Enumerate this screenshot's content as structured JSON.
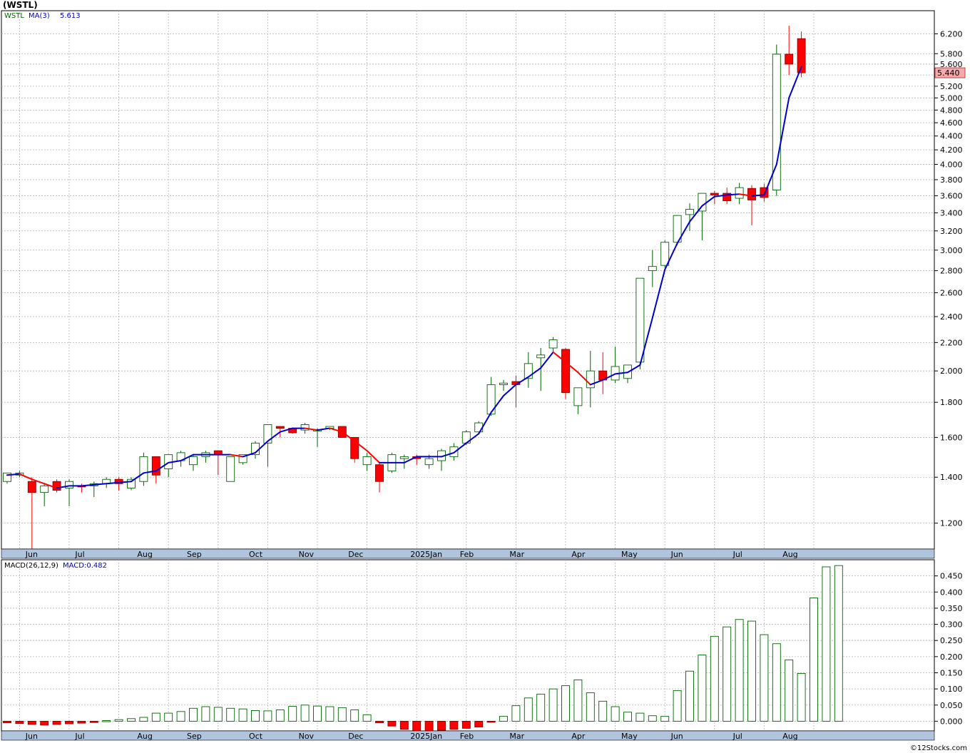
{
  "title": "(WSTL)",
  "copyright": "©12Stocks.com",
  "colors": {
    "up": "#006400",
    "down": "#ff0000",
    "ma_rising": "#0000cd",
    "ma_falling": "#ff0000",
    "axis_band": "#b0c4de",
    "grid": "#b4b4b4",
    "last_label_bg": "#f4aaaa"
  },
  "chart_data": [
    {
      "type": "candlestick",
      "ticker": "WSTL",
      "legend": {
        "ticker": "WSTL",
        "ma_label": "MA(3)",
        "ma_value": "5.613"
      },
      "last_price_label": "5.440",
      "y_scale": "log",
      "ylim": [
        1.1,
        6.7
      ],
      "y_ticks": [
        "1.200",
        "1.400",
        "1.600",
        "1.800",
        "2.000",
        "2.200",
        "2.400",
        "2.600",
        "2.800",
        "3.000",
        "3.200",
        "3.400",
        "3.600",
        "3.800",
        "4.000",
        "4.200",
        "4.400",
        "4.600",
        "4.800",
        "5.000",
        "5.200",
        "5.400",
        "5.600",
        "5.800",
        "6.200"
      ],
      "month_labels": [
        {
          "label": "Jun",
          "week": 2
        },
        {
          "label": "Jul",
          "week": 6
        },
        {
          "label": "Aug",
          "week": 11
        },
        {
          "label": "Sep",
          "week": 15
        },
        {
          "label": "Oct",
          "week": 20
        },
        {
          "label": "Nov",
          "week": 24
        },
        {
          "label": "Dec",
          "week": 28
        },
        {
          "label": "2025Jan",
          "week": 33
        },
        {
          "label": "Feb",
          "week": 37
        },
        {
          "label": "Mar",
          "week": 41
        },
        {
          "label": "Apr",
          "week": 46
        },
        {
          "label": "May",
          "week": 50
        },
        {
          "label": "Jun",
          "week": 54
        },
        {
          "label": "Jul",
          "week": 59
        },
        {
          "label": "Aug",
          "week": 63
        }
      ],
      "candles": [
        {
          "o": 1.38,
          "h": 1.42,
          "l": 1.37,
          "c": 1.42
        },
        {
          "o": 1.41,
          "h": 1.43,
          "l": 1.4,
          "c": 1.42
        },
        {
          "o": 1.38,
          "h": 1.4,
          "l": 1.09,
          "c": 1.33
        },
        {
          "o": 1.33,
          "h": 1.37,
          "l": 1.27,
          "c": 1.36
        },
        {
          "o": 1.38,
          "h": 1.39,
          "l": 1.33,
          "c": 1.34
        },
        {
          "o": 1.35,
          "h": 1.39,
          "l": 1.27,
          "c": 1.38
        },
        {
          "o": 1.36,
          "h": 1.37,
          "l": 1.33,
          "c": 1.355
        },
        {
          "o": 1.36,
          "h": 1.38,
          "l": 1.31,
          "c": 1.37
        },
        {
          "o": 1.37,
          "h": 1.4,
          "l": 1.35,
          "c": 1.39
        },
        {
          "o": 1.39,
          "h": 1.4,
          "l": 1.34,
          "c": 1.37
        },
        {
          "o": 1.35,
          "h": 1.4,
          "l": 1.34,
          "c": 1.39
        },
        {
          "o": 1.38,
          "h": 1.52,
          "l": 1.36,
          "c": 1.5
        },
        {
          "o": 1.5,
          "h": 1.5,
          "l": 1.37,
          "c": 1.41
        },
        {
          "o": 1.44,
          "h": 1.51,
          "l": 1.4,
          "c": 1.51
        },
        {
          "o": 1.48,
          "h": 1.53,
          "l": 1.45,
          "c": 1.52
        },
        {
          "o": 1.46,
          "h": 1.51,
          "l": 1.43,
          "c": 1.5
        },
        {
          "o": 1.5,
          "h": 1.53,
          "l": 1.47,
          "c": 1.52
        },
        {
          "o": 1.53,
          "h": 1.53,
          "l": 1.41,
          "c": 1.51
        },
        {
          "o": 1.38,
          "h": 1.5,
          "l": 1.38,
          "c": 1.5
        },
        {
          "o": 1.47,
          "h": 1.51,
          "l": 1.46,
          "c": 1.51
        },
        {
          "o": 1.51,
          "h": 1.58,
          "l": 1.49,
          "c": 1.57
        },
        {
          "o": 1.57,
          "h": 1.67,
          "l": 1.45,
          "c": 1.67
        },
        {
          "o": 1.66,
          "h": 1.66,
          "l": 1.6,
          "c": 1.65
        },
        {
          "o": 1.65,
          "h": 1.65,
          "l": 1.62,
          "c": 1.625
        },
        {
          "o": 1.64,
          "h": 1.68,
          "l": 1.62,
          "c": 1.67
        },
        {
          "o": 1.64,
          "h": 1.65,
          "l": 1.55,
          "c": 1.64
        },
        {
          "o": 1.65,
          "h": 1.66,
          "l": 1.64,
          "c": 1.66
        },
        {
          "o": 1.66,
          "h": 1.66,
          "l": 1.6,
          "c": 1.6
        },
        {
          "o": 1.6,
          "h": 1.6,
          "l": 1.47,
          "c": 1.49
        },
        {
          "o": 1.46,
          "h": 1.52,
          "l": 1.43,
          "c": 1.5
        },
        {
          "o": 1.46,
          "h": 1.47,
          "l": 1.33,
          "c": 1.38
        },
        {
          "o": 1.43,
          "h": 1.52,
          "l": 1.42,
          "c": 1.51
        },
        {
          "o": 1.49,
          "h": 1.51,
          "l": 1.44,
          "c": 1.5
        },
        {
          "o": 1.5,
          "h": 1.51,
          "l": 1.46,
          "c": 1.49
        },
        {
          "o": 1.46,
          "h": 1.51,
          "l": 1.44,
          "c": 1.49
        },
        {
          "o": 1.48,
          "h": 1.54,
          "l": 1.43,
          "c": 1.53
        },
        {
          "o": 1.5,
          "h": 1.57,
          "l": 1.48,
          "c": 1.55
        },
        {
          "o": 1.57,
          "h": 1.64,
          "l": 1.56,
          "c": 1.63
        },
        {
          "o": 1.63,
          "h": 1.69,
          "l": 1.62,
          "c": 1.68
        },
        {
          "o": 1.73,
          "h": 1.96,
          "l": 1.72,
          "c": 1.91
        },
        {
          "o": 1.91,
          "h": 1.94,
          "l": 1.87,
          "c": 1.92
        },
        {
          "o": 1.93,
          "h": 1.97,
          "l": 1.77,
          "c": 1.91
        },
        {
          "o": 1.95,
          "h": 2.13,
          "l": 1.89,
          "c": 2.05
        },
        {
          "o": 2.09,
          "h": 2.16,
          "l": 1.87,
          "c": 2.11
        },
        {
          "o": 2.16,
          "h": 2.24,
          "l": 2.13,
          "c": 2.22
        },
        {
          "o": 2.15,
          "h": 2.16,
          "l": 1.82,
          "c": 1.86
        },
        {
          "o": 1.78,
          "h": 1.89,
          "l": 1.73,
          "c": 1.89
        },
        {
          "o": 1.89,
          "h": 2.14,
          "l": 1.77,
          "c": 2.0
        },
        {
          "o": 2.0,
          "h": 2.13,
          "l": 1.85,
          "c": 1.94
        },
        {
          "o": 1.94,
          "h": 2.17,
          "l": 1.92,
          "c": 2.03
        },
        {
          "o": 1.95,
          "h": 2.02,
          "l": 1.92,
          "c": 2.04
        },
        {
          "o": 2.06,
          "h": 2.73,
          "l": 2.01,
          "c": 2.73
        },
        {
          "o": 2.8,
          "h": 3.0,
          "l": 2.65,
          "c": 2.84
        },
        {
          "o": 2.85,
          "h": 3.1,
          "l": 2.83,
          "c": 3.08
        },
        {
          "o": 3.08,
          "h": 3.37,
          "l": 3.05,
          "c": 3.37
        },
        {
          "o": 3.38,
          "h": 3.51,
          "l": 3.2,
          "c": 3.44
        },
        {
          "o": 3.42,
          "h": 3.63,
          "l": 3.1,
          "c": 3.63
        },
        {
          "o": 3.63,
          "h": 3.66,
          "l": 3.5,
          "c": 3.61
        },
        {
          "o": 3.63,
          "h": 3.7,
          "l": 3.5,
          "c": 3.54
        },
        {
          "o": 3.57,
          "h": 3.76,
          "l": 3.5,
          "c": 3.7
        },
        {
          "o": 3.69,
          "h": 3.73,
          "l": 3.26,
          "c": 3.55
        },
        {
          "o": 3.7,
          "h": 3.75,
          "l": 3.53,
          "c": 3.58
        },
        {
          "o": 3.67,
          "h": 5.98,
          "l": 3.6,
          "c": 5.79
        },
        {
          "o": 5.79,
          "h": 6.37,
          "l": 5.4,
          "c": 5.6
        },
        {
          "o": 6.1,
          "h": 6.25,
          "l": 5.36,
          "c": 5.44
        }
      ],
      "ma": [
        1.41,
        1.415,
        1.39,
        1.37,
        1.35,
        1.36,
        1.36,
        1.365,
        1.37,
        1.375,
        1.38,
        1.42,
        1.43,
        1.47,
        1.48,
        1.51,
        1.51,
        1.51,
        1.51,
        1.5,
        1.52,
        1.58,
        1.63,
        1.65,
        1.65,
        1.64,
        1.65,
        1.63,
        1.58,
        1.53,
        1.47,
        1.47,
        1.47,
        1.5,
        1.5,
        1.5,
        1.52,
        1.57,
        1.62,
        1.74,
        1.84,
        1.91,
        1.96,
        2.02,
        2.13,
        2.06,
        1.99,
        1.91,
        1.94,
        1.98,
        1.99,
        2.04,
        2.39,
        2.81,
        3.07,
        3.3,
        3.48,
        3.59,
        3.61,
        3.62,
        3.6,
        3.61,
        4.0,
        5.0,
        5.55
      ]
    },
    {
      "type": "bar",
      "legend": {
        "label": "MACD(26,12,9)",
        "value_label": "MACD:0.482"
      },
      "ylim": [
        -0.03,
        0.5
      ],
      "y_ticks": [
        "0.000",
        "0.050",
        "0.100",
        "0.150",
        "0.200",
        "0.250",
        "0.300",
        "0.350",
        "0.400",
        "0.450"
      ],
      "values": [
        -0.005,
        -0.007,
        -0.01,
        -0.012,
        -0.01,
        -0.008,
        -0.006,
        -0.004,
        0.002,
        0.005,
        0.008,
        0.012,
        0.025,
        0.025,
        0.03,
        0.04,
        0.045,
        0.043,
        0.04,
        0.038,
        0.033,
        0.032,
        0.035,
        0.046,
        0.05,
        0.047,
        0.045,
        0.042,
        0.035,
        0.02,
        -0.005,
        -0.015,
        -0.025,
        -0.03,
        -0.03,
        -0.028,
        -0.025,
        -0.022,
        -0.018,
        -0.001,
        0.015,
        0.048,
        0.072,
        0.084,
        0.1,
        0.11,
        0.128,
        0.088,
        0.062,
        0.045,
        0.028,
        0.025,
        0.017,
        0.015,
        0.095,
        0.155,
        0.205,
        0.263,
        0.292,
        0.315,
        0.31,
        0.268,
        0.24,
        0.19,
        0.148,
        0.382,
        0.478,
        0.482
      ]
    }
  ]
}
